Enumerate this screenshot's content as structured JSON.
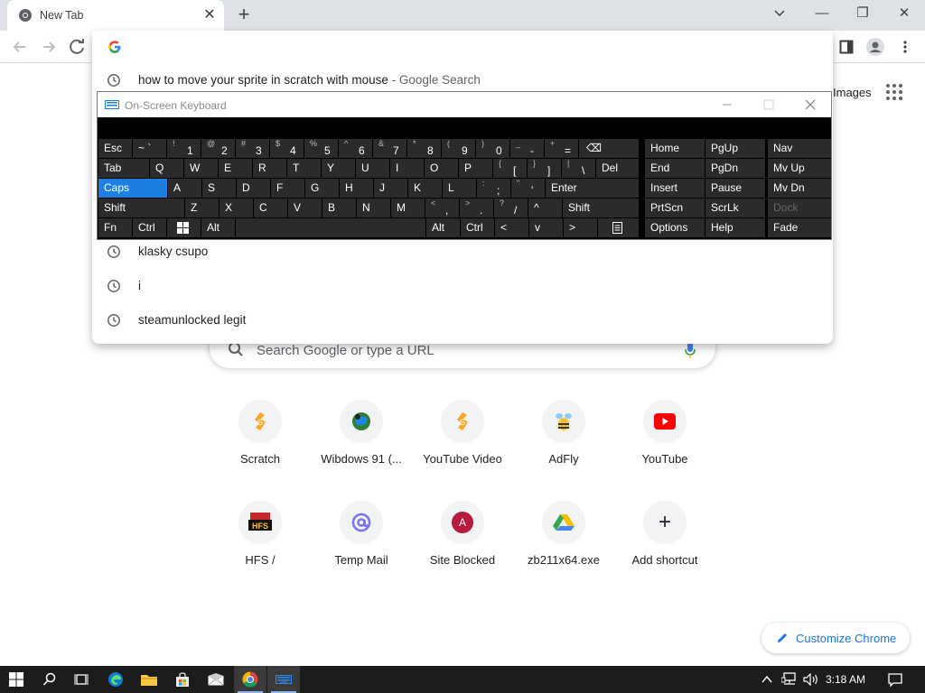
{
  "browser": {
    "tab_title": "New Tab",
    "tab_close": "✕",
    "newtab": "+",
    "window_controls": {
      "minimize": "—",
      "restore": "❐",
      "close": "✕"
    }
  },
  "omnibox": {
    "input_value": "",
    "suggestions": [
      {
        "text": "how to move your sprite in scratch with mouse",
        "suffix": " - Google Search",
        "icon": "history-icon"
      },
      {
        "text": "klasky csupo",
        "suffix": "",
        "icon": "history-icon"
      },
      {
        "text": "i",
        "suffix": "",
        "icon": "history-icon"
      },
      {
        "text": "steamunlocked legit",
        "suffix": "",
        "icon": "history-icon"
      }
    ]
  },
  "ntp": {
    "images_link": "Images",
    "search_placeholder": "Search Google or type a URL",
    "shortcuts": [
      {
        "label": "Scratch",
        "icon": "scratch-icon"
      },
      {
        "label": "Wibdows 91 (...",
        "icon": "globe-icon"
      },
      {
        "label": "YouTube Video",
        "icon": "scratch-icon"
      },
      {
        "label": "AdFly",
        "icon": "adfly-icon"
      },
      {
        "label": "YouTube",
        "icon": "youtube-icon"
      },
      {
        "label": "HFS /",
        "icon": "hfs-icon"
      },
      {
        "label": "Temp Mail",
        "icon": "at-sign-icon"
      },
      {
        "label": "Site Blocked",
        "icon": "letter-a-icon",
        "icon_text": "A"
      },
      {
        "label": "zb211x64.exe",
        "icon": "google-drive-icon"
      },
      {
        "label": "Add shortcut",
        "icon": "plus-icon",
        "icon_text": "+"
      }
    ],
    "customize_label": "Customize Chrome"
  },
  "osk": {
    "title": "On-Screen Keyboard",
    "keys": {
      "esc": "Esc",
      "tilde_top": "~",
      "tilde_main": "`",
      "k1_top": "!",
      "k1": "1",
      "k2_top": "@",
      "k2": "2",
      "k3_top": "#",
      "k3": "3",
      "k4_top": "$",
      "k4": "4",
      "k5_top": "%",
      "k5": "5",
      "k6_top": "^",
      "k6": "6",
      "k7_top": "&",
      "k7": "7",
      "k8_top": "*",
      "k8": "8",
      "k9_top": "(",
      "k9": "9",
      "k0_top": ")",
      "k0": "0",
      "minus_top": "_",
      "minus": "-",
      "equals_top": "+",
      "equals": "=",
      "backspace": "⌫",
      "tab": "Tab",
      "q": "Q",
      "w": "W",
      "e": "E",
      "r": "R",
      "t": "T",
      "y": "Y",
      "u": "U",
      "i": "I",
      "o": "O",
      "p": "P",
      "lbracket_top": "{",
      "lbracket": "[",
      "rbracket_top": "}",
      "rbracket": "]",
      "backslash_top": "|",
      "backslash": "\\",
      "del": "Del",
      "caps": "Caps",
      "a": "A",
      "s": "S",
      "d": "D",
      "f": "F",
      "g": "G",
      "h": "H",
      "j": "J",
      "k": "K",
      "l": "L",
      "semicolon_top": ":",
      "semicolon": ";",
      "quote_top": "\"",
      "quote": "'",
      "enter": "Enter",
      "shift": "Shift",
      "z": "Z",
      "x": "X",
      "c": "C",
      "v": "V",
      "b": "B",
      "n": "N",
      "m": "M",
      "comma_top": "<",
      "comma": ",",
      "period_top": ">",
      "period": ".",
      "slash_top": "?",
      "slash": "/",
      "up": "^",
      "shift_r": "Shift",
      "fn": "Fn",
      "ctrl": "Ctrl",
      "alt": "Alt",
      "alt_r": "Alt",
      "ctrl_r": "Ctrl",
      "left": "<",
      "down": "v",
      "right": ">",
      "home": "Home",
      "pgup": "PgUp",
      "nav": "Nav",
      "end": "End",
      "pgdn": "PgDn",
      "mvup": "Mv Up",
      "insert": "Insert",
      "pause": "Pause",
      "mvdn": "Mv Dn",
      "prtscn": "PrtScn",
      "scrlk": "ScrLk",
      "dock": "Dock",
      "options": "Options",
      "help": "Help",
      "fade": "Fade"
    }
  },
  "taskbar": {
    "clock": "3:18 AM"
  },
  "colors": {
    "accent": "#1a73e8",
    "caps_highlight": "#1e7fe3",
    "taskbar": "#1c1c1c"
  }
}
